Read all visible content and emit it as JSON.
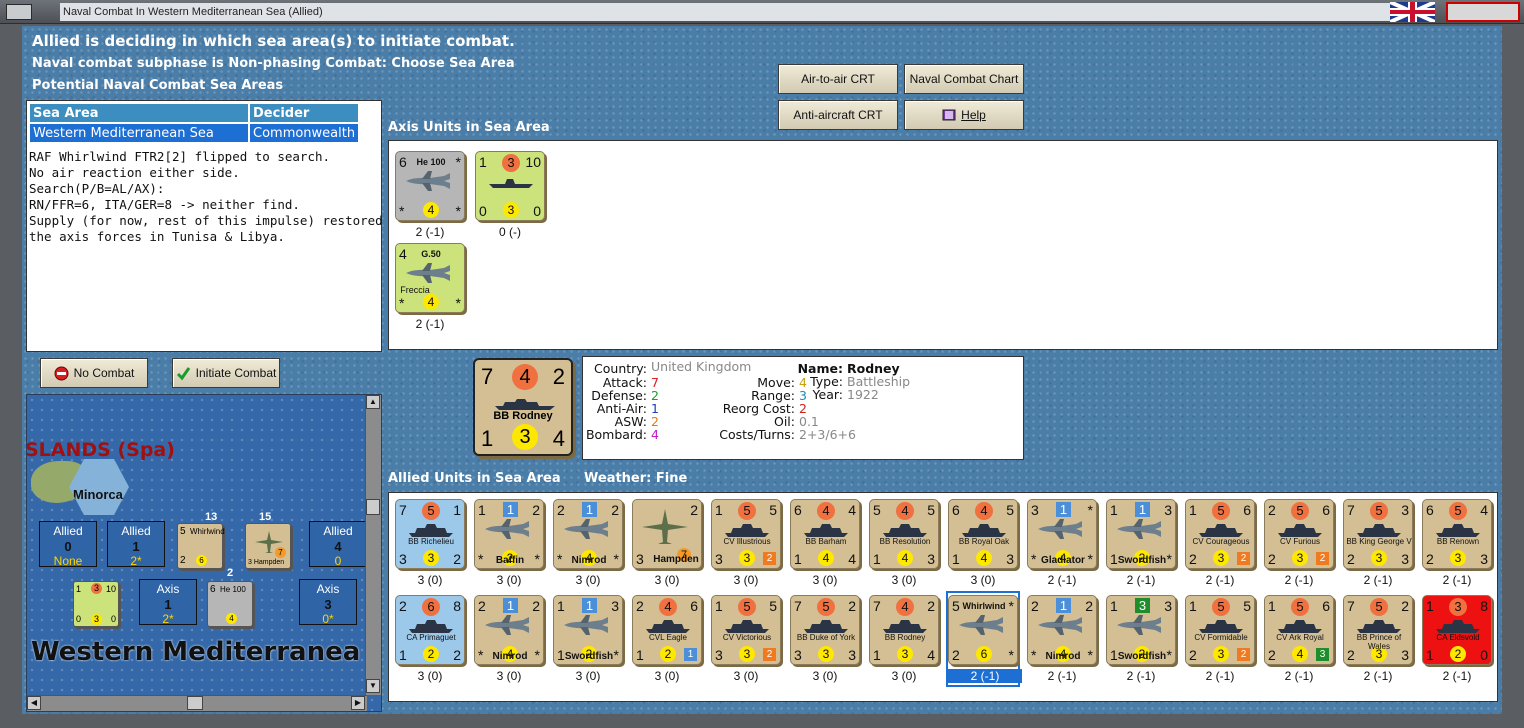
{
  "window": {
    "title": "Naval Combat In Western Mediterranean Sea (Allied)"
  },
  "status": {
    "line1": "Allied is deciding in which sea area(s) to initiate combat.",
    "line2": "Naval combat subphase is Non-phasing Combat: Choose Sea Area",
    "line3": "Potential Naval Combat Sea Areas"
  },
  "buttons": {
    "air_to_air": "Air-to-air CRT",
    "naval_chart": "Naval Combat Chart",
    "anti_aircraft": "Anti-aircraft CRT",
    "help": "Help",
    "no_combat": "No Combat",
    "initiate": "Initiate Combat"
  },
  "sea_table": {
    "headers": [
      "Sea Area",
      "Decider"
    ],
    "rows": [
      [
        "Western Mediterranean Sea",
        "Commonwealth"
      ]
    ]
  },
  "log": "RAF Whirlwind FTR2[2] flipped to search.\nNo air reaction either side.\nSearch(P/B=AL/AX):\nRN/FFR=6, ITA/GER=8 -> neither find.\nSupply (for now, rest of this impulse) restored to\nthe axis forces in Tunisa & Libya.",
  "panels": {
    "axis_title": "Axis Units in Sea Area",
    "allied_title": "Allied Units in Sea Area",
    "weather": "Weather:  Fine"
  },
  "axis_units": [
    {
      "kind": "air",
      "color": "gray",
      "tl": "6",
      "name": "He 100",
      "tr": "*",
      "bl": "*",
      "bc": "4",
      "br": "*",
      "caption": "2 (-1)"
    },
    {
      "kind": "sub",
      "color": "green",
      "tl": "1",
      "tc": "3",
      "tr": "10",
      "bl": "0",
      "bc": "3",
      "br": "0",
      "caption": "0 (-)"
    },
    {
      "kind": "air",
      "color": "green",
      "tl": "4",
      "name": "G.50",
      "sub": "Freccia",
      "tr": "",
      "bl": "*",
      "bc": "4",
      "br": "*",
      "caption": "2 (-1)"
    }
  ],
  "selected_unit": {
    "attack": "7",
    "cost": "4",
    "defense": "2",
    "name": "BB Rodney",
    "aa": "1",
    "bombard": "3",
    "move": "4",
    "info": {
      "Country": "United Kingdom",
      "Attack": "7",
      "Defense": "2",
      "Anti-Air": "1",
      "ASW": "2",
      "Bombard": "4",
      "Move": "4",
      "Range": "3",
      "Reorg Cost": "2",
      "Oil": "0.1",
      "Costs/Turns": "2+3/6+6",
      "Name": "Rodney",
      "Type": "Battleship",
      "Year": "1922"
    },
    "labels": {
      "country": "Country:",
      "attack": "Attack:",
      "defense": "Defense:",
      "aa": "Anti-Air:",
      "asw": "ASW:",
      "bombard": "Bombard:",
      "move": "Move:",
      "range": "Range:",
      "reorg": "Reorg Cost:",
      "oil": "Oil:",
      "costs": "Costs/Turns:",
      "name": "Name:",
      "type": "Type:",
      "year": "Year:"
    }
  },
  "allied_units_row1": [
    {
      "kind": "ship",
      "color": "blue",
      "tl": "7",
      "tc": "5",
      "tr": "1",
      "name": "BB Richelieu",
      "bl": "3",
      "bc": "3",
      "br": "2",
      "caption": "3 (0)"
    },
    {
      "kind": "air",
      "color": "tan",
      "tl": "1",
      "tc": "1",
      "tr": "2",
      "name": "Baffin",
      "bl": "*",
      "bc": "2",
      "br": "*",
      "caption": "3 (0)"
    },
    {
      "kind": "air",
      "color": "tan",
      "tl": "2",
      "tc": "1",
      "tr": "2",
      "name": "Nimrod",
      "bl": "*",
      "bc": "4",
      "br": "*",
      "caption": "3 (0)"
    },
    {
      "kind": "bomber",
      "color": "tan",
      "tl": "",
      "tc": "",
      "tr": "2",
      "name": "Hampden",
      "bl": "3",
      "bc": "",
      "br": "7",
      "caption": "3 (0)"
    },
    {
      "kind": "ship",
      "color": "tan",
      "tl": "1",
      "tc": "5",
      "tr": "5",
      "name": "CV Illustrious",
      "bl": "3",
      "bc": "3",
      "br": "2",
      "caption": "3 (0)"
    },
    {
      "kind": "ship",
      "color": "tan",
      "tl": "6",
      "tc": "4",
      "tr": "4",
      "name": "BB Barham",
      "bl": "1",
      "bc": "4",
      "br": "4",
      "caption": "3 (0)"
    },
    {
      "kind": "ship",
      "color": "tan",
      "tl": "5",
      "tc": "4",
      "tr": "5",
      "name": "BB Resolution",
      "bl": "1",
      "bc": "4",
      "br": "3",
      "caption": "3 (0)"
    },
    {
      "kind": "ship",
      "color": "tan",
      "tl": "6",
      "tc": "4",
      "tr": "5",
      "name": "BB Royal Oak",
      "bl": "1",
      "bc": "4",
      "br": "3",
      "caption": "3 (0)"
    },
    {
      "kind": "air",
      "color": "tan",
      "tl": "3",
      "tc": "1",
      "tr": "*",
      "name": "Gladiator",
      "bl": "*",
      "bc": "4",
      "br": "*",
      "caption": "2 (-1)"
    },
    {
      "kind": "air",
      "color": "tan",
      "tl": "1",
      "tc": "1",
      "tr": "3",
      "name": "Swordfish",
      "bl": "1",
      "bc": "2",
      "br": "*",
      "caption": "2 (-1)"
    },
    {
      "kind": "ship",
      "color": "tan",
      "tl": "1",
      "tc": "5",
      "tr": "6",
      "name": "CV Courageous",
      "bl": "2",
      "bc": "3",
      "br": "2",
      "caption": "2 (-1)"
    },
    {
      "kind": "ship",
      "color": "tan",
      "tl": "2",
      "tc": "5",
      "tr": "6",
      "name": "CV Furious",
      "bl": "2",
      "bc": "3",
      "br": "2",
      "caption": "2 (-1)"
    },
    {
      "kind": "ship",
      "color": "tan",
      "tl": "7",
      "tc": "5",
      "tr": "3",
      "name": "BB King George V",
      "bl": "2",
      "bc": "3",
      "br": "3",
      "caption": "2 (-1)"
    },
    {
      "kind": "ship",
      "color": "tan",
      "tl": "6",
      "tc": "5",
      "tr": "4",
      "name": "BB Renown",
      "bl": "2",
      "bc": "3",
      "br": "3",
      "caption": "2 (-1)"
    }
  ],
  "allied_units_row2": [
    {
      "kind": "ship",
      "color": "blue",
      "tl": "2",
      "tc": "6",
      "tr": "8",
      "name": "CA Primaguet",
      "bl": "1",
      "bc": "2",
      "br": "2",
      "caption": "3 (0)"
    },
    {
      "kind": "air",
      "color": "tan",
      "tl": "2",
      "tc": "1",
      "tr": "2",
      "name": "Nimrod",
      "bl": "*",
      "bc": "4",
      "br": "*",
      "caption": "3 (0)"
    },
    {
      "kind": "air",
      "color": "tan",
      "tl": "1",
      "tc": "1",
      "tr": "3",
      "name": "Swordfish",
      "bl": "1",
      "bc": "2",
      "br": "*",
      "caption": "3 (0)"
    },
    {
      "kind": "ship",
      "color": "tan",
      "tl": "2",
      "tc": "4",
      "tr": "6",
      "name": "CVL Eagle",
      "bl": "1",
      "bc": "2",
      "br": "1",
      "caption": "3 (0)"
    },
    {
      "kind": "ship",
      "color": "tan",
      "tl": "1",
      "tc": "5",
      "tr": "5",
      "name": "CV Victorious",
      "bl": "3",
      "bc": "3",
      "br": "2",
      "caption": "3 (0)"
    },
    {
      "kind": "ship",
      "color": "tan",
      "tl": "7",
      "tc": "5",
      "tr": "2",
      "name": "BB Duke of York",
      "bl": "3",
      "bc": "3",
      "br": "3",
      "caption": "3 (0)"
    },
    {
      "kind": "ship",
      "color": "tan",
      "tl": "7",
      "tc": "4",
      "tr": "2",
      "name": "BB Rodney",
      "bl": "1",
      "bc": "3",
      "br": "4",
      "caption": "3 (0)"
    },
    {
      "kind": "air",
      "color": "tan",
      "tl": "5",
      "tc": "",
      "tr": "*",
      "name": "Whirlwind",
      "bl": "2",
      "bc": "6",
      "br": "*",
      "caption": "2 (-1)",
      "selected": true
    },
    {
      "kind": "air",
      "color": "tan",
      "tl": "2",
      "tc": "1",
      "tr": "2",
      "name": "Nimrod",
      "bl": "*",
      "bc": "4",
      "br": "*",
      "caption": "2 (-1)"
    },
    {
      "kind": "air",
      "color": "tan",
      "tl": "1",
      "tc": "3",
      "tr": "3",
      "name": "Swordfish",
      "bl": "1",
      "bc": "2",
      "br": "*",
      "caption": "2 (-1)"
    },
    {
      "kind": "ship",
      "color": "tan",
      "tl": "1",
      "tc": "5",
      "tr": "5",
      "name": "CV Formidable",
      "bl": "2",
      "bc": "3",
      "br": "2",
      "caption": "2 (-1)"
    },
    {
      "kind": "ship",
      "color": "tan",
      "tl": "1",
      "tc": "5",
      "tr": "6",
      "name": "CV Ark Royal",
      "bl": "2",
      "bc": "4",
      "br": "3",
      "caption": "2 (-1)"
    },
    {
      "kind": "ship",
      "color": "tan",
      "tl": "7",
      "tc": "5",
      "tr": "2",
      "name": "BB Prince of Wales",
      "bl": "2",
      "bc": "3",
      "br": "3",
      "caption": "2 (-1)"
    },
    {
      "kind": "ship",
      "color": "red",
      "tl": "1",
      "tc": "3",
      "tr": "8",
      "name": "CA Eldsvold",
      "bl": "1",
      "bc": "2",
      "br": "0",
      "caption": "2 (-1)"
    }
  ],
  "map": {
    "title": "SLANDS (Spa)",
    "island": "Minorca",
    "sea_name": "Western Mediterranea",
    "boxes": [
      {
        "side": "Allied",
        "value": "0",
        "sub": "None"
      },
      {
        "side": "Allied",
        "value": "1",
        "sub": "2*"
      },
      {
        "side": "Allied",
        "value": "4",
        "sub": "0"
      },
      {
        "side": "Axis",
        "value": "1",
        "sub": "2*"
      },
      {
        "side": "Axis",
        "value": "3",
        "sub": "0*"
      }
    ],
    "stack_counts": [
      "13",
      "15",
      "2"
    ],
    "mini_counters": {
      "whirlwind": {
        "tl": "5",
        "name": "Whirlwind",
        "bl": "2",
        "bc": "6"
      },
      "hampden": {
        "tl": "",
        "name": "3 Hampden",
        "br": "7"
      },
      "sub": {
        "tl": "1",
        "tc": "3",
        "tr": "10",
        "bl": "0",
        "bc": "3",
        "br": "0"
      },
      "he100": {
        "tl": "6",
        "name": "He 100",
        "bc": "4"
      }
    }
  },
  "colors": {
    "accent": "#1d6fd3",
    "header": "#3c8ec0",
    "counter_tan": "#d3bf93",
    "counter_blue": "#9cc8ea"
  }
}
